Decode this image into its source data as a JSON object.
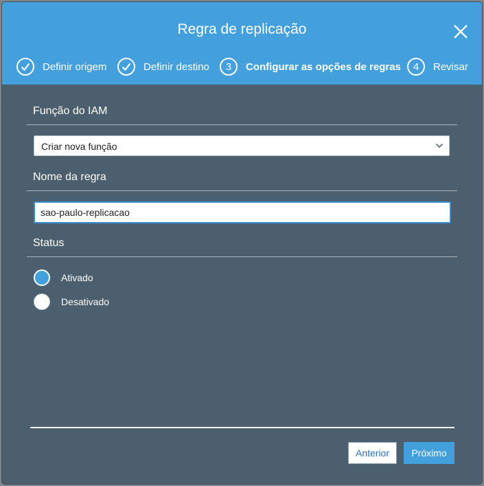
{
  "modal": {
    "title": "Regra de replicação",
    "steps": [
      {
        "label": "Definir origem",
        "state": "done"
      },
      {
        "label": "Definir destino",
        "state": "done"
      },
      {
        "number": "3",
        "label": "Configurar as opções de regras",
        "state": "active"
      },
      {
        "number": "4",
        "label": "Revisar",
        "state": "pending"
      }
    ]
  },
  "form": {
    "iam_role": {
      "label": "Função do IAM",
      "selected": "Criar nova função"
    },
    "rule_name": {
      "label": "Nome da regra",
      "value": "sao-paulo-replicacao"
    },
    "status": {
      "label": "Status",
      "options": [
        {
          "label": "Ativado",
          "checked": true
        },
        {
          "label": "Desativado",
          "checked": false
        }
      ]
    }
  },
  "footer": {
    "prev_label": "Anterior",
    "next_label": "Próximo"
  },
  "colors": {
    "header_blue": "#44a0dc",
    "modal_body": "#4b5f6e",
    "input_focus": "#3b8fd1",
    "link_blue": "#2e73b8"
  },
  "icons": {
    "close": "close-icon",
    "step_done": "check-circle-icon",
    "select": "chevron-down-icon"
  }
}
